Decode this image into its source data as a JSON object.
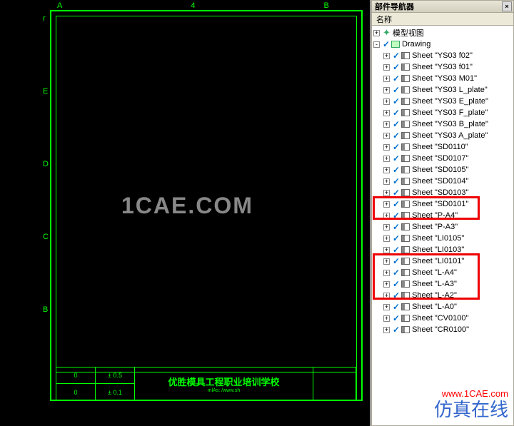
{
  "canvas": {
    "ruler_top": [
      "A",
      "4",
      "B"
    ],
    "ruler_left": [
      "r",
      "E",
      "D",
      "C",
      "B"
    ],
    "watermark": "1CAE.COM",
    "title_block": {
      "c1a": "0",
      "c1b": "0",
      "c2a": "± 0.5",
      "c2b": "± 0.1",
      "title": "优胜模具工程职业培训学校",
      "sub": "mlAs: /www.sh"
    }
  },
  "panel": {
    "title": "部件导航器",
    "column": "名称",
    "root": "模型视图",
    "drawing": "Drawing",
    "sheets": [
      "Sheet \"YS03 f02\"",
      "Sheet \"YS03 f01\"",
      "Sheet \"YS03 M01\"",
      "Sheet \"YS03 L_plate\"",
      "Sheet \"YS03 E_plate\"",
      "Sheet \"YS03 F_plate\"",
      "Sheet \"YS03 B_plate\"",
      "Sheet \"YS03 A_plate\"",
      "Sheet \"SD0110\"",
      "Sheet \"SD0107\"",
      "Sheet \"SD0105\"",
      "Sheet \"SD0104\"",
      "Sheet \"SD0103\"",
      "Sheet \"SD0101\"",
      "Sheet \"P-A4\"",
      "Sheet \"P-A3\"",
      "Sheet \"LI0105\"",
      "Sheet \"LI0103\"",
      "Sheet \"LI0101\"",
      "Sheet \"L-A4\"",
      "Sheet \"L-A3\"",
      "Sheet \"L-A2\"",
      "Sheet \"L-A0\"",
      "Sheet \"CV0100\"",
      "Sheet \"CR0100\""
    ]
  },
  "overlay": {
    "brand": "仿真在线",
    "url": "www.1CAE.com"
  }
}
